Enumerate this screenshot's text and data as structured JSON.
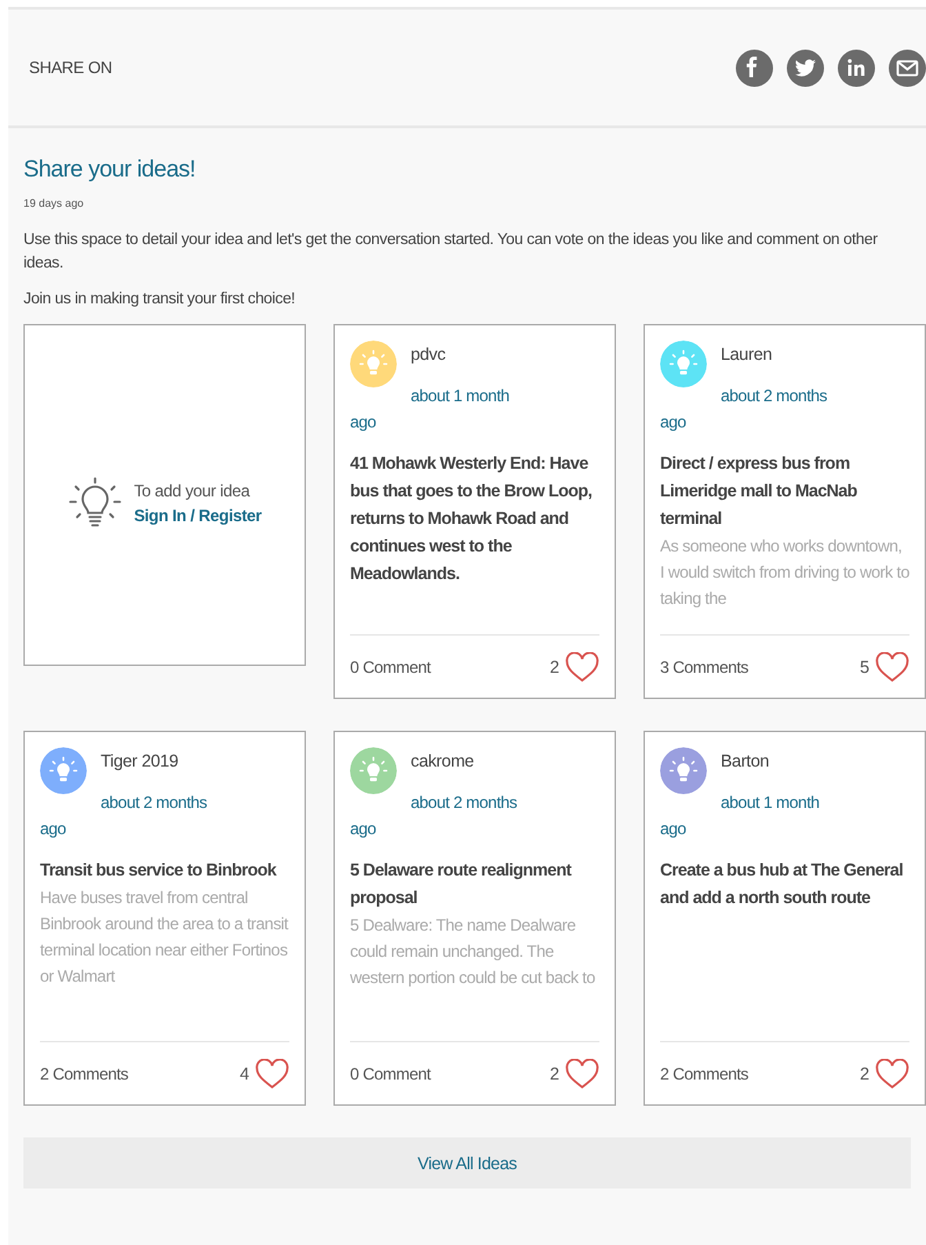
{
  "share": {
    "label": "SHARE ON",
    "networks": [
      {
        "kind": "facebook"
      },
      {
        "kind": "twitter"
      },
      {
        "kind": "linkedin"
      },
      {
        "kind": "email"
      }
    ]
  },
  "intro": {
    "title": "Share your ideas!",
    "date": "19 days ago",
    "paragraphs": [
      "Use this space to detail your idea and let's get the conversation started. You can vote on the ideas you like and comment on other ideas.",
      "Join us in making transit your first choice!"
    ]
  },
  "add_idea": {
    "prompt": "To add your idea",
    "link": "Sign In / Register"
  },
  "ideas": [
    {
      "author": "pdvc",
      "color": "#ffd97a",
      "time": "about 1 month ago",
      "title": "41 Mohawk Westerly End: Have bus that goes to the Brow Loop, returns to Mohawk Road and continues west to the Meadowlands.",
      "comments": "0 Comment",
      "likes": "2"
    },
    {
      "author": "Lauren",
      "color": "#5de3f5",
      "time": "about 2 months ago",
      "title": "Direct / express bus from Limeridge mall to MacNab terminal",
      "description": "As someone who works downtown, I would switch from driving to work to taking the",
      "comments": "3 Comments",
      "likes": "5"
    },
    {
      "author": "Tiger 2019",
      "color": "#7eaefc",
      "time": "about 2 months ago",
      "title": "Transit bus service to Binbrook",
      "description": "Have buses travel from central Binbrook around the area to a transit terminal location near either Fortinos or Walmart",
      "comments": "2 Comments",
      "likes": "4"
    },
    {
      "author": "cakrome",
      "color": "#9dd79f",
      "time": "about 2 months ago",
      "title": "5 Delaware route realignment proposal",
      "description": "5 Dealware: The name Dealware could remain unchanged. The western portion could be cut back to",
      "comments": "0 Comment",
      "likes": "2"
    },
    {
      "author": "Barton",
      "color": "#9a9fdf",
      "time": "about 1 month ago",
      "title": "Create a bus hub at The General and add a north south route",
      "comments": "2 Comments",
      "likes": "2"
    }
  ],
  "view_all": "View All Ideas"
}
